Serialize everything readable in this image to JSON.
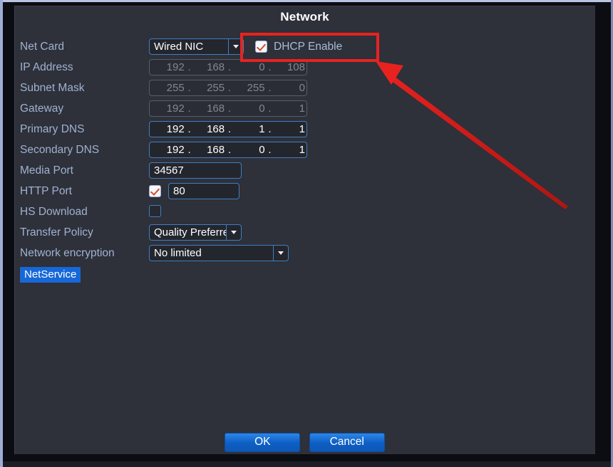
{
  "dialog": {
    "title": "Network"
  },
  "rows": {
    "net_card": {
      "label": "Net Card",
      "value": "Wired NIC",
      "dhcp_label": "DHCP Enable",
      "dhcp_checked": true
    },
    "ip_address": {
      "label": "IP Address",
      "octets": [
        "192",
        "168",
        "0",
        "108"
      ],
      "enabled": false
    },
    "subnet_mask": {
      "label": "Subnet Mask",
      "octets": [
        "255",
        "255",
        "255",
        "0"
      ],
      "enabled": false
    },
    "gateway": {
      "label": "Gateway",
      "octets": [
        "192",
        "168",
        "0",
        "1"
      ],
      "enabled": false
    },
    "primary_dns": {
      "label": "Primary DNS",
      "octets": [
        "192",
        "168",
        "1",
        "1"
      ],
      "enabled": true
    },
    "secondary_dns": {
      "label": "Secondary DNS",
      "octets": [
        "192",
        "168",
        "0",
        "1"
      ],
      "enabled": true
    },
    "media_port": {
      "label": "Media Port",
      "value": "34567"
    },
    "http_port": {
      "label": "HTTP Port",
      "value": "80",
      "checked": true
    },
    "hs_download": {
      "label": "HS Download",
      "checked": false
    },
    "transfer_policy": {
      "label": "Transfer Policy",
      "value": "Quality Preferred"
    },
    "network_encryption": {
      "label": "Network encryption",
      "value": "No limited"
    },
    "netservice": {
      "label": "NetService"
    }
  },
  "footer": {
    "ok_label": "OK",
    "cancel_label": "Cancel"
  },
  "annotation": {
    "highlight_color": "#e8231f",
    "target": "DHCP Enable"
  },
  "dots": {
    "sep": "."
  }
}
